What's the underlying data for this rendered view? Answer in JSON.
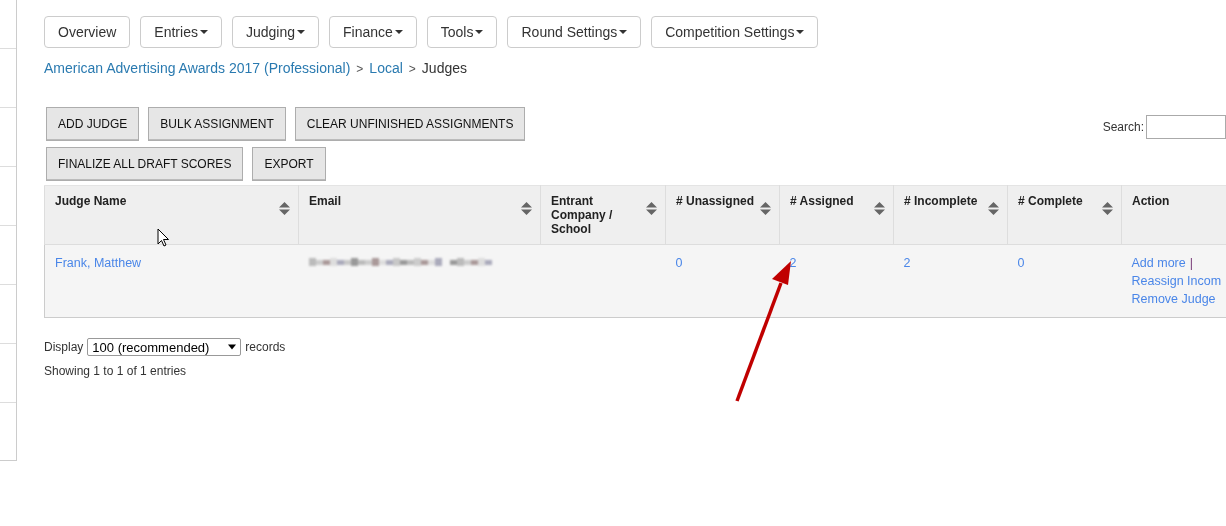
{
  "nav": [
    {
      "label": "Overview",
      "dropdown": false
    },
    {
      "label": "Entries",
      "dropdown": true
    },
    {
      "label": "Judging",
      "dropdown": true
    },
    {
      "label": "Finance",
      "dropdown": true
    },
    {
      "label": "Tools",
      "dropdown": true
    },
    {
      "label": "Round Settings",
      "dropdown": true
    },
    {
      "label": "Competition Settings",
      "dropdown": true
    }
  ],
  "breadcrumb": {
    "separator": ">",
    "items": [
      {
        "label": "American Advertising Awards 2017 (Professional)",
        "link": true
      },
      {
        "label": "Local",
        "link": true
      },
      {
        "label": "Judges",
        "link": false
      }
    ]
  },
  "action_rows": [
    [
      "ADD JUDGE",
      "BULK ASSIGNMENT",
      "CLEAR UNFINISHED ASSIGNMENTS"
    ],
    [
      "FINALIZE ALL DRAFT SCORES",
      "EXPORT"
    ]
  ],
  "search": {
    "label": "Search:"
  },
  "table": {
    "columns": [
      {
        "label": "Judge Name",
        "sortable": true
      },
      {
        "label": "Email",
        "sortable": true
      },
      {
        "label": "Entrant Company / School",
        "sortable": true
      },
      {
        "label": "# Unassigned",
        "sortable": true
      },
      {
        "label": "# Assigned",
        "sortable": true
      },
      {
        "label": "# Incomplete",
        "sortable": true
      },
      {
        "label": "# Complete",
        "sortable": true
      },
      {
        "label": "Action",
        "sortable": false
      }
    ],
    "rows": [
      {
        "cells": [
          {
            "kind": "link",
            "text": "Frank, Matthew"
          },
          {
            "kind": "redacted"
          },
          {
            "kind": "empty"
          },
          {
            "kind": "link",
            "text": "0"
          },
          {
            "kind": "link",
            "text": "2"
          },
          {
            "kind": "link",
            "text": "2"
          },
          {
            "kind": "link",
            "text": "0"
          },
          {
            "kind": "actions",
            "links": [
              {
                "label": "Add more",
                "separator": "|"
              },
              {
                "label": "Reassign Incom"
              },
              {
                "label": "Remove Judge"
              }
            ]
          }
        ]
      }
    ]
  },
  "footer": {
    "display_label": "Display",
    "page_size": "100 (recommended)",
    "records_label": "records",
    "info": "Showing 1 to 1 of 1 entries"
  }
}
